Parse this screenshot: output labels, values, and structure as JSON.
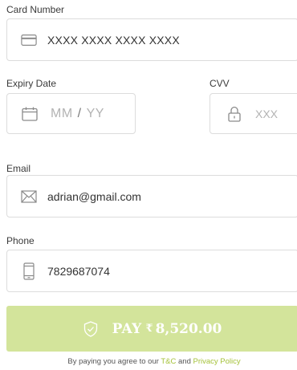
{
  "card": {
    "label": "Card Number",
    "placeholder": "XXXX XXXX XXXX XXXX",
    "icon": "credit-card-icon"
  },
  "expiry": {
    "label": "Expiry Date",
    "mm_placeholder": "MM",
    "separator": "/",
    "yy_placeholder": "YY",
    "icon": "calendar-icon"
  },
  "cvv": {
    "label": "CVV",
    "placeholder": "XXX",
    "icon": "lock-icon"
  },
  "email": {
    "label": "Email",
    "value": "adrian@gmail.com",
    "icon": "envelope-icon"
  },
  "phone": {
    "label": "Phone",
    "value": "7829687074",
    "icon": "phone-icon"
  },
  "pay_button": {
    "label": "PAY",
    "currency": "₹",
    "amount": "8,520.00",
    "icon": "shield-check-icon",
    "color": "#d3e49b"
  },
  "terms": {
    "prefix": "By paying you agree to our",
    "tc_link": "T&C",
    "joiner": "and",
    "privacy_link": "Privacy Policy",
    "link_color": "#a5c23a"
  }
}
